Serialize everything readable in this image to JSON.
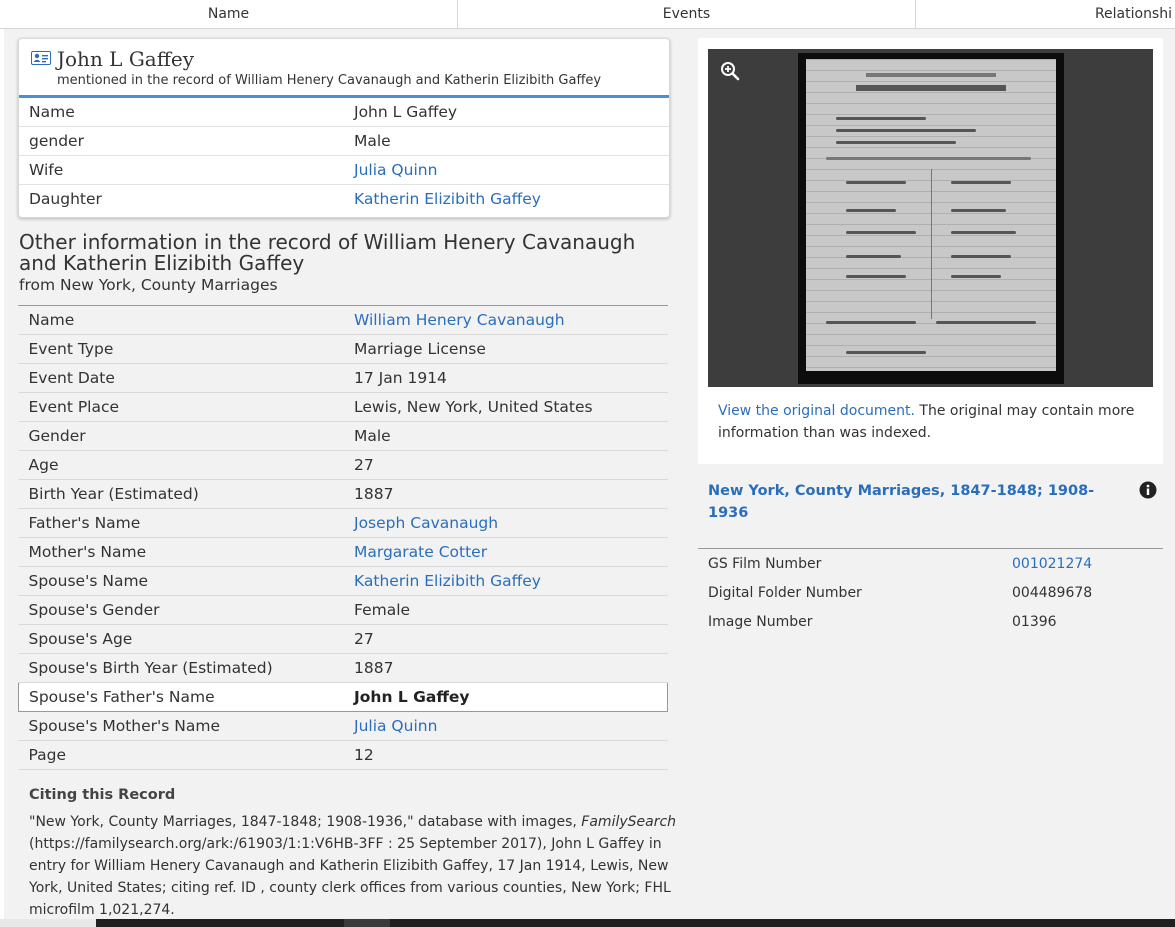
{
  "tabs": [
    "Name",
    "Events",
    "Relationshi"
  ],
  "person": {
    "name": "John L Gaffey",
    "subtitle": "mentioned in the record of William Henery Cavanaugh and Katherin Elizibith Gaffey",
    "rows": [
      {
        "label": "Name",
        "value": "John L Gaffey",
        "link": false
      },
      {
        "label": "gender",
        "value": "Male",
        "link": false
      },
      {
        "label": "Wife",
        "value": "Julia Quinn",
        "link": true
      },
      {
        "label": "Daughter",
        "value": "Katherin Elizibith Gaffey",
        "link": true
      }
    ]
  },
  "other": {
    "title": "Other information in the record of William Henery Cavanaugh and Katherin Elizibith Gaffey",
    "source": "from New York, County Marriages",
    "rows": [
      {
        "label": "Name",
        "value": "William Henery Cavanaugh",
        "link": true
      },
      {
        "label": "Event Type",
        "value": "Marriage License",
        "link": false
      },
      {
        "label": "Event Date",
        "value": "17 Jan 1914",
        "link": false
      },
      {
        "label": "Event Place",
        "value": "Lewis, New York, United States",
        "link": false
      },
      {
        "label": "Gender",
        "value": "Male",
        "link": false
      },
      {
        "label": "Age",
        "value": "27",
        "link": false
      },
      {
        "label": "Birth Year (Estimated)",
        "value": "1887",
        "link": false
      },
      {
        "label": "Father's Name",
        "value": "Joseph Cavanaugh",
        "link": true
      },
      {
        "label": "Mother's Name",
        "value": "Margarate Cotter",
        "link": true
      },
      {
        "label": "Spouse's Name",
        "value": "Katherin Elizibith Gaffey",
        "link": true
      },
      {
        "label": "Spouse's Gender",
        "value": "Female",
        "link": false
      },
      {
        "label": "Spouse's Age",
        "value": "27",
        "link": false
      },
      {
        "label": "Spouse's Birth Year (Estimated)",
        "value": "1887",
        "link": false
      },
      {
        "label": "Spouse's Father's Name",
        "value": "John L Gaffey",
        "link": false,
        "highlight": true
      },
      {
        "label": "Spouse's Mother's Name",
        "value": "Julia Quinn",
        "link": true
      },
      {
        "label": "Page",
        "value": "12",
        "link": false
      }
    ]
  },
  "citing": {
    "title": "Citing this Record",
    "part1": "\"New York, County Marriages, 1847-1848; 1908-1936,\" database with images, ",
    "site": "FamilySearch",
    "part2": " (https://familysearch.org/ark:/61903/1:1:V6HB-3FF : 25 September 2017), John L Gaffey in entry for William Henery Cavanaugh and Katherin Elizibith Gaffey, 17 Jan 1914, Lewis, New York, United States; citing ref. ID , county clerk offices from various counties, New York; FHL microfilm 1,021,274."
  },
  "image": {
    "link_text": "View the original document.",
    "note": " The original may contain more information than was indexed."
  },
  "collection": {
    "title": "New York, County Marriages, 1847-1848; 1908-1936",
    "rows": [
      {
        "label": "GS Film Number",
        "value": "001021274",
        "link": true
      },
      {
        "label": "Digital Folder Number",
        "value": "004489678",
        "link": false
      },
      {
        "label": "Image Number",
        "value": "01396",
        "link": false
      }
    ]
  },
  "colors": {
    "link": "#2a6ebb",
    "accent": "#4a8fd6"
  },
  "icons": [
    "person-card-icon",
    "zoom-in-icon",
    "info-icon"
  ]
}
